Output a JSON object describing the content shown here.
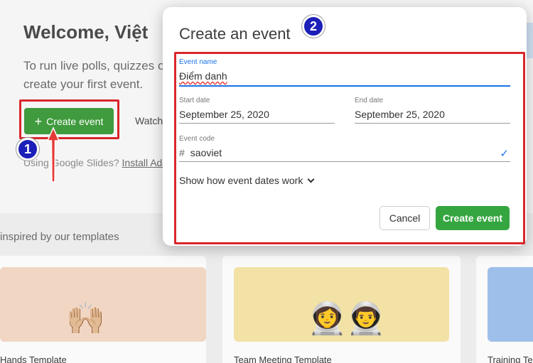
{
  "page": {
    "welcome": "Welcome, Việt",
    "intro_line1": "To run live polls, quizzes o",
    "intro_line2": "create your first event.",
    "create_event_label": "Create event",
    "watch_label": "Watch",
    "slides_prefix": "Using Google Slides? ",
    "slides_link": "Install Add-c",
    "inspired": "inspired by our templates",
    "templates": [
      {
        "title": "Hands Template",
        "emoji": "🙌🏼"
      },
      {
        "title": "Team Meeting Template",
        "emoji": "👩‍🚀👨‍🚀"
      },
      {
        "title": "Training Te"
      }
    ]
  },
  "annotations": {
    "step1": "1",
    "step2": "2"
  },
  "dialog": {
    "title": "Create an event",
    "event_name": {
      "label": "Event name",
      "value": "Điểm danh"
    },
    "start_date": {
      "label": "Start date",
      "value": "September 25, 2020"
    },
    "end_date": {
      "label": "End date",
      "value": "September 25, 2020"
    },
    "event_code": {
      "label": "Event code",
      "prefix": "#",
      "value": "saoviet"
    },
    "show_how": "Show how event dates work",
    "cancel_label": "Cancel",
    "create_label": "Create event"
  },
  "colors": {
    "primary_green": "#35a540",
    "annotation_red": "#d9262b",
    "badge_blue": "#1c1fb8",
    "focus_blue": "#1a73e8"
  }
}
